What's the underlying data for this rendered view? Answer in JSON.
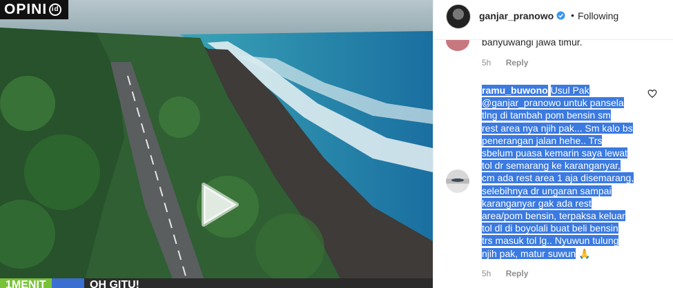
{
  "video": {
    "logo_text": "OPINI",
    "logo_badge": "id",
    "caption_tag": "1MENIT",
    "caption_text": "OH GITU!"
  },
  "post_header": {
    "username": "ganjar_pranowo",
    "separator": "•",
    "follow_label": "Following"
  },
  "previous_comment": {
    "text": "banyuwangi jawa timur.",
    "time": "5h",
    "reply_label": "Reply"
  },
  "comment": {
    "username": "ramu_buwono",
    "lines": [
      "Usul Pak",
      "@ganjar_pranowo untuk pansela",
      "tlng di tambah pom bensin sm",
      "rest area nya njih pak... Sm kalo bs",
      "penerangan jalan hehe.. Trs",
      "sbelum puasa kemarin saya lewat",
      "tol dr semarang ke karanganyar,",
      "cm ada rest area 1 aja disemarang,",
      "selebihnya dr ungaran sampai",
      "karanganyar gak ada rest",
      "area/pom bensin, terpaksa keluar",
      "tol dl di boyolali buat beli bensin",
      "trs masuk tol lg.. Nyuwun tulung",
      "njih pak, matur suwun"
    ],
    "emoji": "🙏",
    "time": "5h",
    "reply_label": "Reply"
  }
}
